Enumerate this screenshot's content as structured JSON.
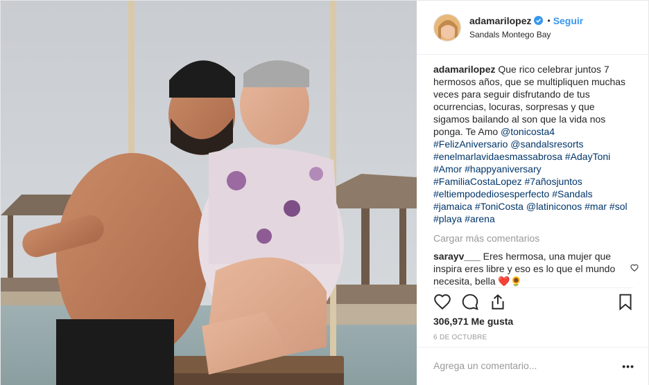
{
  "post": {
    "username": "adamarilopez",
    "follow_label": "Seguir",
    "dot": "•",
    "location": "Sandals Montego Bay",
    "caption": {
      "username": "adamarilopez",
      "text": " Que rico celebrar juntos 7 hermosos años, que se multipliquen muchas veces para seguir disfrutando de tus ocurrencias, locuras, sorpresas y que sigamos bailando al son que la vida nos ponga. Te Amo ",
      "mention1": "@tonicosta4",
      "tags_line1": "#FelizAniversario",
      "mention2": "@sandalsresorts",
      "tag3": "#enelmarlavidaesmassabrosa",
      "tag4": "#AdayToni",
      "tag5": "#Amor",
      "tag6": "#happyaniversary",
      "tag7": "#FamiliaCostaLopez",
      "tag8": "#7añosjuntos",
      "tag9": "#eltiempodediosesperfecto",
      "tag10": "#Sandals",
      "tag11": "#jamaica",
      "tag12": "#ToniCosta",
      "mention3": "@latiniconos",
      "tag13": "#mar",
      "tag14": "#sol",
      "tag15": "#playa",
      "tag16": "#arena"
    },
    "load_more": "Cargar más comentarios",
    "comment": {
      "username": "sarayv___",
      "text": " Eres hermosa, una mujer que inspira eres libre y eso es lo que el mundo necesita, bella ",
      "emoji": "❤️🌻"
    },
    "likes": "306,971 Me gusta",
    "date": "6 DE OCTUBRE",
    "add_comment_placeholder": "Agrega un comentario...",
    "more_label": "•••"
  },
  "icons": {
    "verified": "verified-badge-icon",
    "like": "heart-icon",
    "comment": "comment-icon",
    "share": "share-icon",
    "save": "bookmark-icon",
    "comment_like": "heart-outline-icon"
  },
  "colors": {
    "link": "#003569",
    "follow": "#3897f0",
    "muted": "#999999",
    "heart_red": "#ed4956"
  }
}
